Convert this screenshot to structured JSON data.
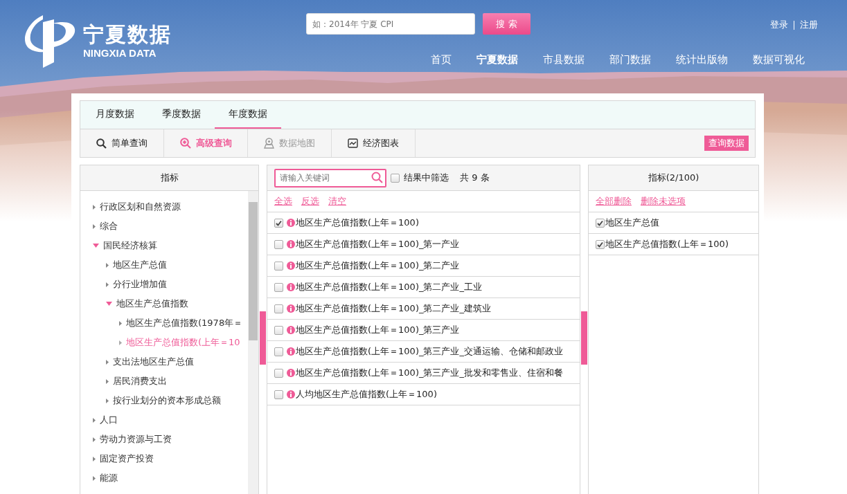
{
  "header": {
    "logo_title": "宁夏数据",
    "logo_subtitle": "NINGXIA DATA",
    "search": {
      "placeholder": "如：2014年 宁夏 CPI"
    },
    "search_button": "搜 索",
    "account_links": [
      "登录",
      "注册"
    ],
    "nav": [
      {
        "label": "首页",
        "selected": false
      },
      {
        "label": "宁夏数据",
        "selected": true
      },
      {
        "label": "市县数据",
        "selected": false
      },
      {
        "label": "部门数据",
        "selected": false
      },
      {
        "label": "统计出版物",
        "selected": false
      },
      {
        "label": "数据可视化",
        "selected": false
      }
    ]
  },
  "tabs": [
    {
      "label": "月度数据",
      "selected": false
    },
    {
      "label": "季度数据",
      "selected": false
    },
    {
      "label": "年度数据",
      "selected": true
    }
  ],
  "toolbar": {
    "items": [
      {
        "label": "简单查询",
        "kind": "search",
        "selected": false,
        "disabled": false
      },
      {
        "label": "高级查询",
        "kind": "zoom",
        "selected": true,
        "disabled": false
      },
      {
        "label": "数据地图",
        "kind": "map",
        "selected": false,
        "disabled": true
      },
      {
        "label": "经济图表",
        "kind": "chart",
        "selected": false,
        "disabled": false
      }
    ],
    "query_button": "查询数据"
  },
  "indicator_tree": {
    "title": "指标",
    "items": [
      {
        "label": "行政区划和自然资源",
        "expanded": false,
        "selected": false
      },
      {
        "label": "综合",
        "expanded": false,
        "selected": false
      },
      {
        "label": "国民经济核算",
        "expanded": true,
        "selected": false,
        "children": [
          {
            "label": "地区生产总值",
            "expanded": false,
            "selected": false
          },
          {
            "label": "分行业增加值",
            "expanded": false,
            "selected": false
          },
          {
            "label": "地区生产总值指数",
            "expanded": true,
            "selected": false,
            "children": [
              {
                "label": "地区生产总值指数(1978年＝",
                "expanded": false,
                "selected": false
              },
              {
                "label": "地区生产总值指数(上年＝10",
                "expanded": false,
                "selected": true
              }
            ]
          },
          {
            "label": "支出法地区生产总值",
            "expanded": false,
            "selected": false
          },
          {
            "label": "居民消费支出",
            "expanded": false,
            "selected": false
          },
          {
            "label": "按行业划分的资本形成总额",
            "expanded": false,
            "selected": false
          }
        ]
      },
      {
        "label": "人口",
        "expanded": false,
        "selected": false
      },
      {
        "label": "劳动力资源与工资",
        "expanded": false,
        "selected": false
      },
      {
        "label": "固定资产投资",
        "expanded": false,
        "selected": false
      },
      {
        "label": "能源",
        "expanded": false,
        "selected": false
      }
    ]
  },
  "results": {
    "keyword": {
      "placeholder": "请输入关键词"
    },
    "filter_in_results": {
      "label": "结果中筛选",
      "checked": false
    },
    "count": "共 9 条",
    "actions": [
      "全选",
      "反选",
      "清空"
    ],
    "rows": [
      {
        "label": "地区生产总值指数(上年＝100)",
        "checked": true
      },
      {
        "label": "地区生产总值指数(上年＝100)_第一产业",
        "checked": false
      },
      {
        "label": "地区生产总值指数(上年＝100)_第二产业",
        "checked": false
      },
      {
        "label": "地区生产总值指数(上年＝100)_第二产业_工业",
        "checked": false
      },
      {
        "label": "地区生产总值指数(上年＝100)_第二产业_建筑业",
        "checked": false
      },
      {
        "label": "地区生产总值指数(上年＝100)_第三产业",
        "checked": false
      },
      {
        "label": "地区生产总值指数(上年＝100)_第三产业_交通运输、仓储和邮政业",
        "checked": false
      },
      {
        "label": "地区生产总值指数(上年＝100)_第三产业_批发和零售业、住宿和餐",
        "checked": false
      },
      {
        "label": "人均地区生产总值指数(上年＝100)",
        "checked": false
      }
    ]
  },
  "selected_panel": {
    "title": "指标(2/100)",
    "actions": [
      "全部删除",
      "删除未选项"
    ],
    "rows": [
      {
        "label": "地区生产总值",
        "checked": true
      },
      {
        "label": "地区生产总值指数(上年＝100)",
        "checked": true
      }
    ]
  }
}
